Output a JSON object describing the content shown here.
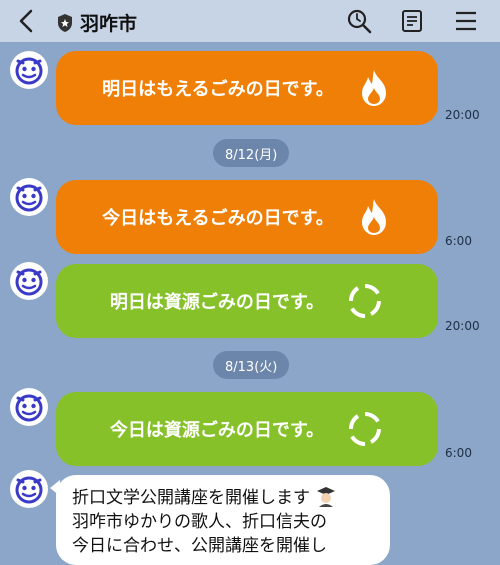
{
  "header": {
    "back_icon": "chevron-left-icon",
    "badge_icon": "shield-icon",
    "title": "羽咋市",
    "actions": [
      "search-icon",
      "note-icon",
      "menu-icon"
    ]
  },
  "colors": {
    "background": "#8ba6c8",
    "orange_bubble": "#f07f08",
    "green_bubble": "#86c12a"
  },
  "messages": [
    {
      "text": "明日はもえるごみの日です。",
      "icon": "flame-icon",
      "time": "20:00"
    },
    {
      "date": "8/12(月)"
    },
    {
      "text": "今日はもえるごみの日です。",
      "icon": "flame-icon",
      "time": "6:00"
    },
    {
      "text": "明日は資源ごみの日です。",
      "icon": "recycle-icon",
      "time": "20:00"
    },
    {
      "date": "8/13(火)"
    },
    {
      "text": "今日は資源ごみの日です。",
      "icon": "recycle-icon",
      "time": "6:00"
    }
  ],
  "last_message": {
    "line1": "折口文学公開講座を開催します",
    "line2": "羽咋市ゆかりの歌人、折口信夫の",
    "line3": "今日に合わせ、公開講座を開催し"
  }
}
